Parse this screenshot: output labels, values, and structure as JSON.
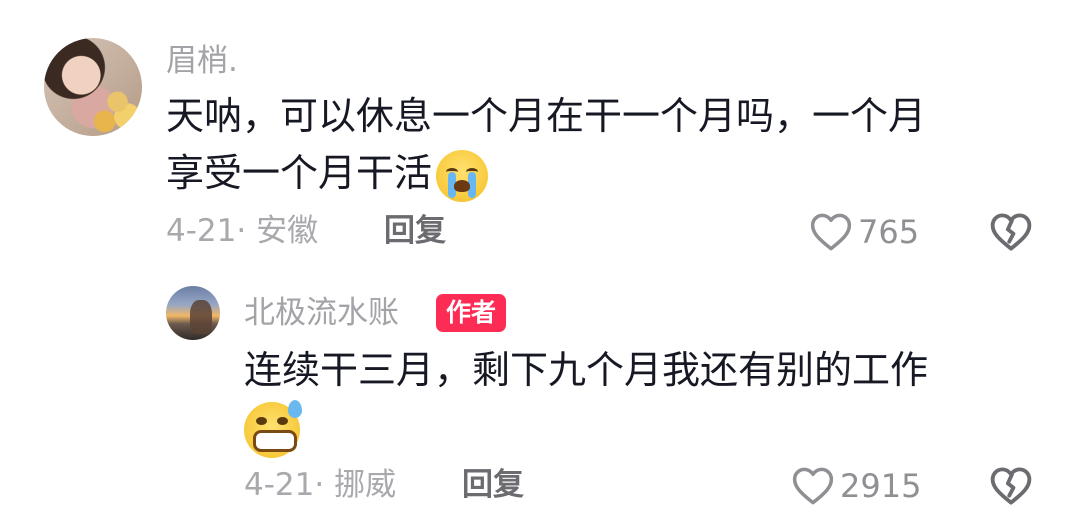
{
  "comments": [
    {
      "username": "眉梢.",
      "text_line1": "天呐，可以休息一个月在干一个月吗，一个月",
      "text_line2": "享受一个月干活",
      "emoji": "loudly-crying-face",
      "meta": "4-21· 安徽",
      "reply_label": "回复",
      "likes": "765"
    },
    {
      "username": "北极流水账",
      "badge": "作者",
      "text_line1": "连续干三月，剩下九个月我还有别的工作",
      "emoji": "grinning-face-with-sweat",
      "meta": "4-21· 挪威",
      "reply_label": "回复",
      "likes": "2915"
    }
  ],
  "colors": {
    "badge": "#fd2c55",
    "text": "#161823",
    "muted": "#a3a3a8"
  }
}
